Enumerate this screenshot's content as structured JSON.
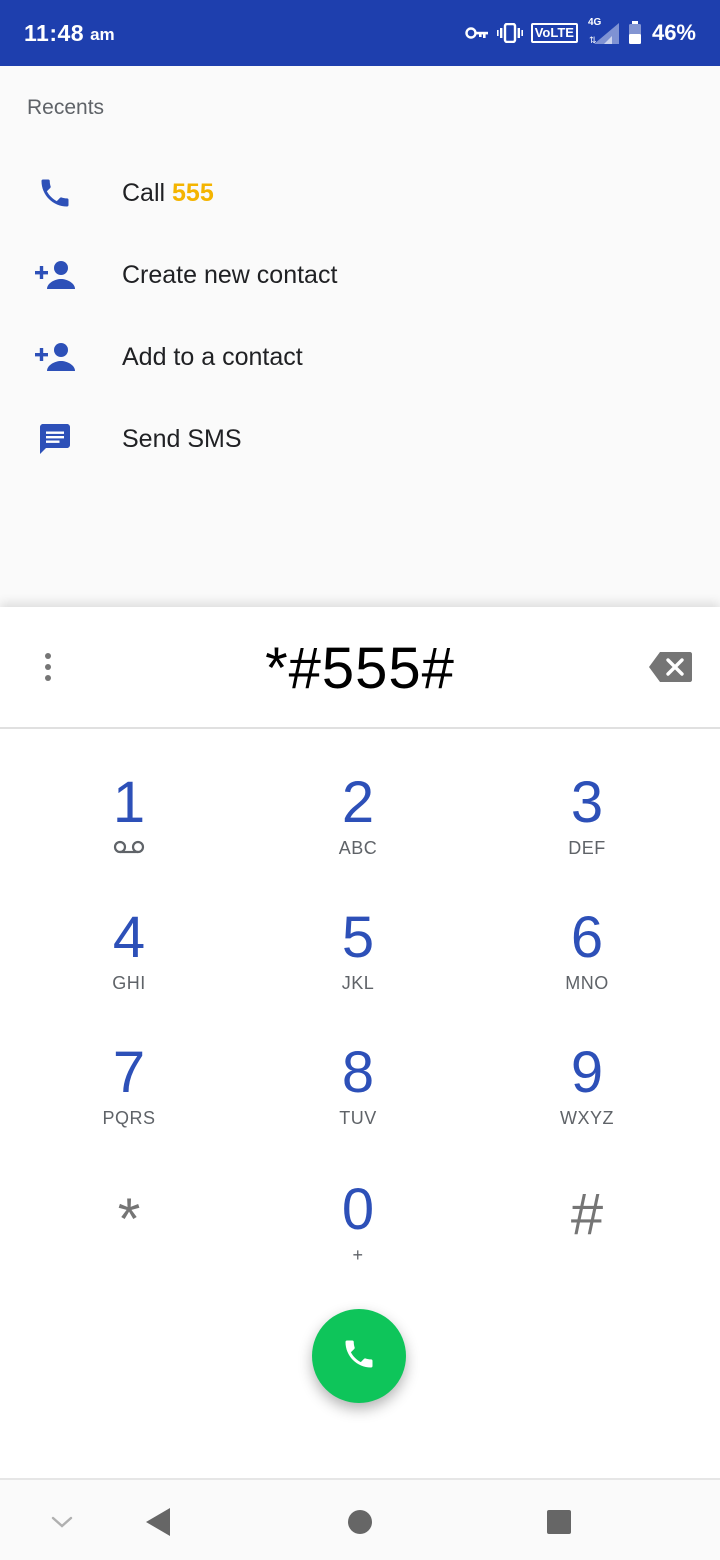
{
  "status_bar": {
    "time": "11:48",
    "ampm": "am",
    "network_badge": "VoLTE",
    "network_type": "4G",
    "battery": "46%",
    "icons": [
      "vpn-key-icon",
      "vibrate-icon",
      "volte-icon",
      "signal-icon",
      "battery-icon"
    ]
  },
  "recents": {
    "title": "Recents",
    "actions": [
      {
        "icon": "phone-icon",
        "label": "Call ",
        "highlight": "555"
      },
      {
        "icon": "add-person-icon",
        "label": "Create new contact"
      },
      {
        "icon": "add-person-icon",
        "label": "Add to a contact"
      },
      {
        "icon": "message-icon",
        "label": "Send SMS"
      }
    ]
  },
  "dialpad": {
    "entered_digits": "*#555#",
    "keys": [
      {
        "digit": "1",
        "letters": ""
      },
      {
        "digit": "2",
        "letters": "ABC"
      },
      {
        "digit": "3",
        "letters": "DEF"
      },
      {
        "digit": "4",
        "letters": "GHI"
      },
      {
        "digit": "5",
        "letters": "JKL"
      },
      {
        "digit": "6",
        "letters": "MNO"
      },
      {
        "digit": "7",
        "letters": "PQRS"
      },
      {
        "digit": "8",
        "letters": "TUV"
      },
      {
        "digit": "9",
        "letters": "WXYZ"
      },
      {
        "digit": "*",
        "letters": ""
      },
      {
        "digit": "0",
        "letters": "+"
      },
      {
        "digit": "#",
        "letters": ""
      }
    ]
  },
  "colors": {
    "status_bar": "#1e3fae",
    "accent": "#2d50b8",
    "highlight": "#f4b400",
    "call_button": "#0ec55a"
  },
  "nav_bar": {
    "icons": [
      "chevron-down-icon",
      "back-icon",
      "home-icon",
      "recents-icon"
    ]
  }
}
